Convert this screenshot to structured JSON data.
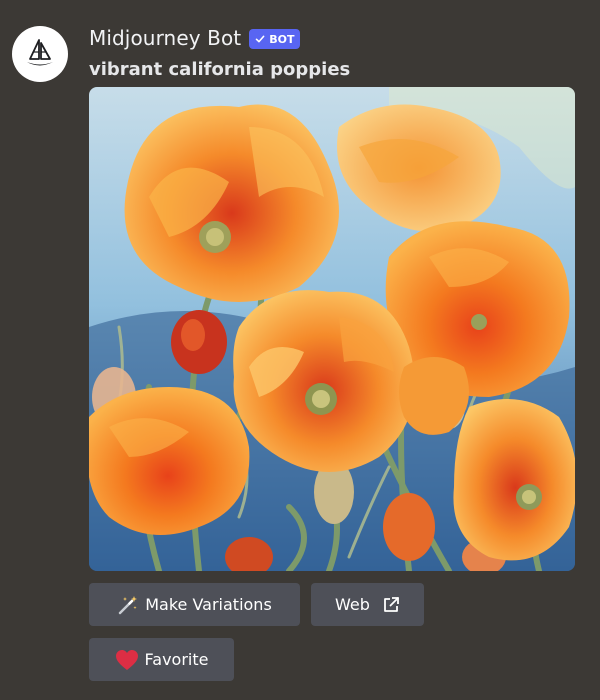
{
  "author": {
    "name": "Midjourney Bot",
    "avatar_icon": "sailboat-logo-icon",
    "badge": {
      "label": "BOT",
      "check_icon": "checkmark-icon",
      "color": "#5865f2"
    }
  },
  "message": {
    "prompt": "vibrant california poppies",
    "attachment": {
      "type": "image",
      "subject": "painting-of-orange-poppies"
    }
  },
  "buttons": {
    "make_variations": {
      "label": "Make Variations",
      "icon": "magic-wand-icon"
    },
    "web": {
      "label": "Web",
      "icon": "external-link-icon"
    },
    "favorite": {
      "label": "Favorite",
      "icon": "heart-icon"
    }
  },
  "colors": {
    "background": "#3c3935",
    "button": "#4e5058",
    "heart": "#dd2e44"
  }
}
